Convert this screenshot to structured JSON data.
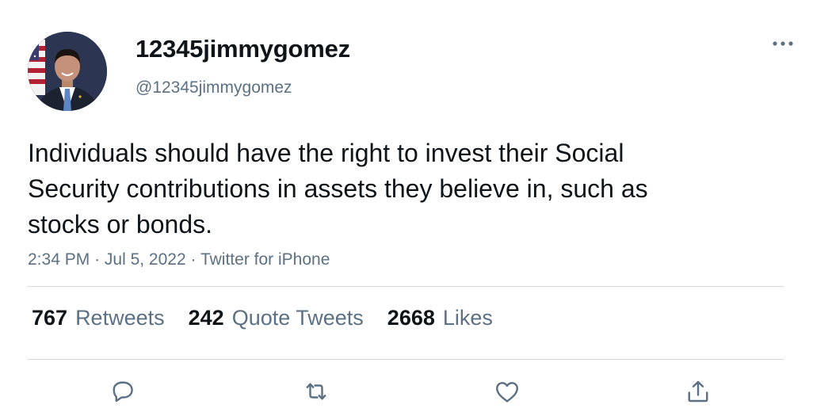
{
  "author": {
    "display_name": "12345jimmygomez",
    "handle": "@12345jimmygomez",
    "avatar_icon": "profile-photo"
  },
  "tweet": {
    "text": "Individuals should have the right to invest their Social Security contributions in assets they believe in, such as stocks or bonds.",
    "time": "2:34 PM",
    "separator": "·",
    "date": "Jul 5, 2022",
    "source": "Twitter for iPhone"
  },
  "stats": [
    {
      "count": "767",
      "label": "Retweets"
    },
    {
      "count": "242",
      "label": "Quote Tweets"
    },
    {
      "count": "2668",
      "label": "Likes"
    }
  ],
  "actions": {
    "reply_icon": "reply-icon",
    "retweet_icon": "retweet-icon",
    "like_icon": "heart-icon",
    "share_icon": "share-icon",
    "more_icon": "more-horizontal-icon"
  },
  "colors": {
    "text_primary": "#0f1419",
    "text_secondary": "#5b7083",
    "divider": "#cfd9de"
  }
}
